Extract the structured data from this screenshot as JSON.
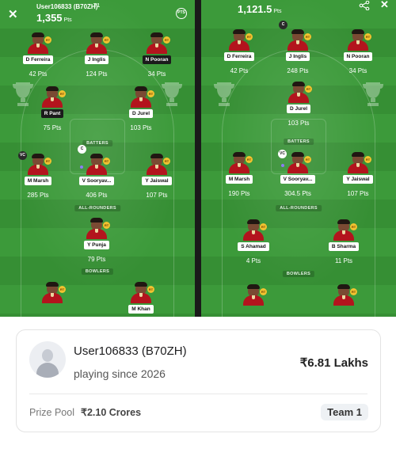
{
  "left_pane": {
    "user": "User106833 (B70ZH)",
    "team_tag": "T1",
    "points_value": "1,355",
    "points_unit": "Pts",
    "pts_icon": "PTS",
    "sections": {
      "batters": "BATTERS",
      "allrounders": "ALL-ROUNDERS",
      "bowlers": "BOWLERS"
    },
    "players": [
      {
        "name": "D Ferreira",
        "pts": "42 Pts"
      },
      {
        "name": "J Inglis",
        "pts": "124 Pts"
      },
      {
        "name": "N Pooran",
        "pts": "34 Pts"
      },
      {
        "name": "R Pant",
        "pts": "75 Pts"
      },
      {
        "name": "D Jurel",
        "pts": "103 Pts"
      },
      {
        "name": "M Marsh",
        "pts": "285 Pts",
        "badge": "VC"
      },
      {
        "name": "V Sooryav...",
        "pts": "406 Pts",
        "badge": "C"
      },
      {
        "name": "Y Jaiswal",
        "pts": "107 Pts"
      },
      {
        "name": "Y Punja",
        "pts": "79 Pts"
      },
      {
        "name": "",
        "pts": ""
      },
      {
        "name": "M Khan",
        "pts": ""
      }
    ]
  },
  "right_pane": {
    "points_value": "1,121.5",
    "points_unit": "Pts",
    "sections": {
      "batters": "BATTERS",
      "allrounders": "ALL-ROUNDERS",
      "bowlers": "BOWLERS"
    },
    "players": [
      {
        "name": "D Ferreira",
        "pts": "42 Pts"
      },
      {
        "name": "J Inglis",
        "pts": "248 Pts",
        "badge": "C"
      },
      {
        "name": "N Pooran",
        "pts": "34 Pts"
      },
      {
        "name": "D Jurel",
        "pts": "103 Pts"
      },
      {
        "name": "M Marsh",
        "pts": "190 Pts"
      },
      {
        "name": "V Sooryav...",
        "pts": "304.5 Pts",
        "badge": "VC"
      },
      {
        "name": "Y Jaiswal",
        "pts": "107 Pts"
      },
      {
        "name": "S Ahamad",
        "pts": "4 Pts"
      },
      {
        "name": "B Sharma",
        "pts": "11 Pts"
      }
    ]
  },
  "card": {
    "username": "User106833 (B70ZH)",
    "since": "playing since 2026",
    "prize": "₹6.81 Lakhs",
    "pool_label": "Prize Pool",
    "pool_value": "₹2.10 Crores",
    "team": "Team 1"
  },
  "icons": {
    "close": "close-icon",
    "share": "share-icon",
    "pts": "pts-icon",
    "trophy": "trophy-watermark-icon"
  },
  "colors": {
    "pitch": "#3c9a3a",
    "jersey": "#b3141d",
    "team_dot": "#f2c230"
  }
}
